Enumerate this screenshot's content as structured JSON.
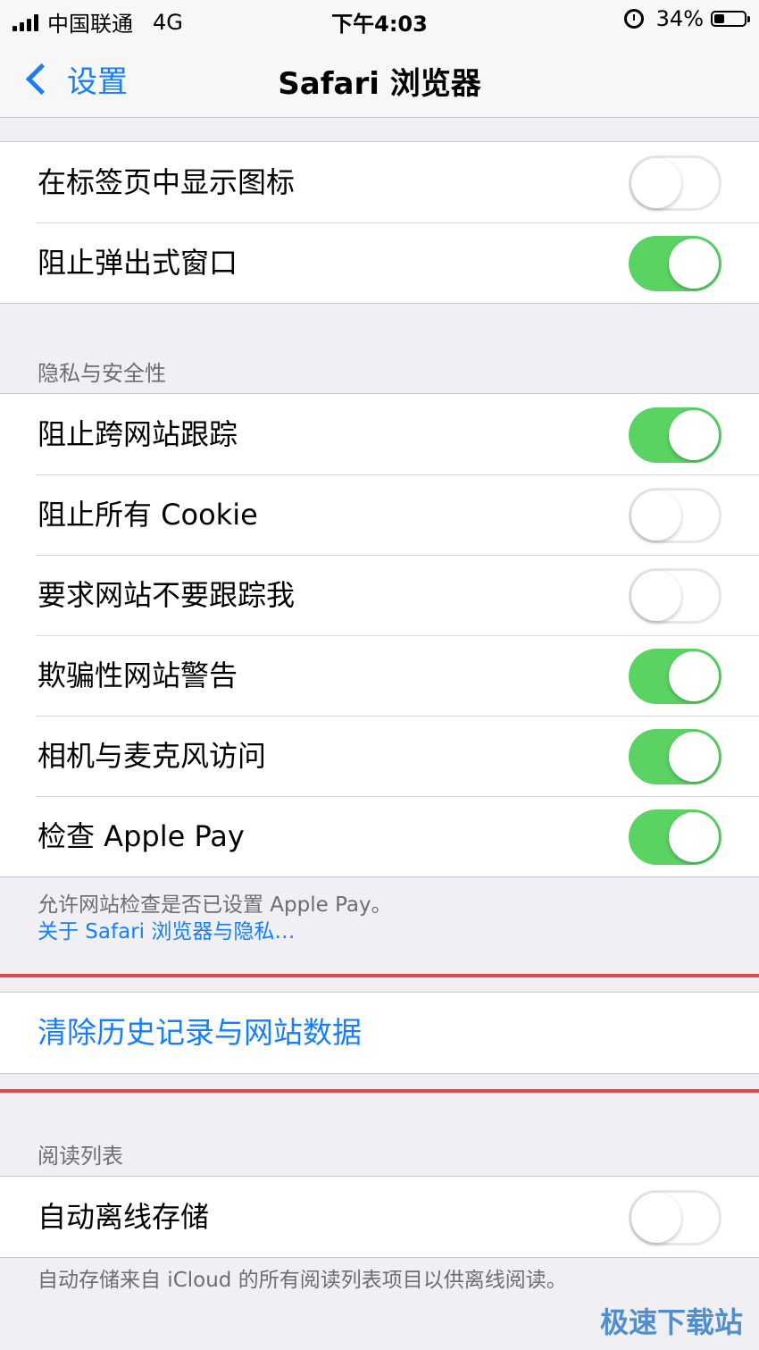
{
  "status_bar": {
    "carrier": "中国联通",
    "network": "4G",
    "time": "下午4:03",
    "battery": "34%",
    "battery_level": 0.34
  },
  "nav": {
    "back_label": "设置",
    "title": "Safari 浏览器"
  },
  "general_rows": [
    {
      "label": "在标签页中显示图标",
      "on": false
    },
    {
      "label": "阻止弹出式窗口",
      "on": true
    }
  ],
  "privacy": {
    "header": "隐私与安全性",
    "rows": [
      {
        "label": "阻止跨网站跟踪",
        "on": true
      },
      {
        "label": "阻止所有 Cookie",
        "on": false
      },
      {
        "label": "要求网站不要跟踪我",
        "on": false
      },
      {
        "label": "欺骗性网站警告",
        "on": true
      },
      {
        "label": "相机与麦克风访问",
        "on": true
      },
      {
        "label": "检查 Apple Pay",
        "on": true
      }
    ],
    "footer": "允许网站检查是否已设置 Apple Pay。",
    "footer_link": "关于 Safari 浏览器与隐私…"
  },
  "clear_history": "清除历史记录与网站数据",
  "reading_list": {
    "header": "阅读列表",
    "row": {
      "label": "自动离线存储",
      "on": false
    },
    "footer": "自动存储来自 iCloud 的所有阅读列表项目以供离线阅读。"
  },
  "watermark": "极速下载站",
  "colors": {
    "accent": "#157efb",
    "toggle_on": "#5bd363",
    "highlight_red": "#e0464a"
  }
}
